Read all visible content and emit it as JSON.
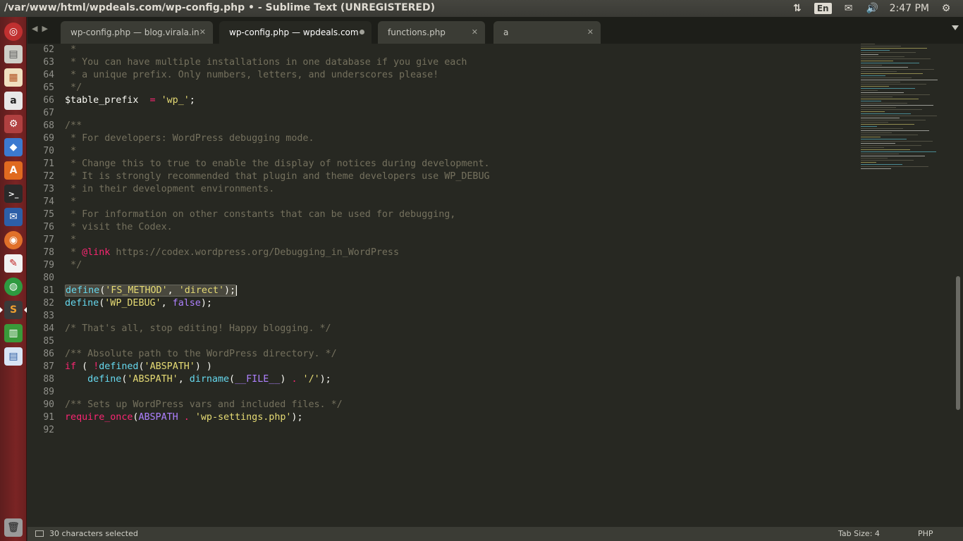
{
  "window_title": "/var/www/html/wpdeals.com/wp-config.php • - Sublime Text (UNREGISTERED)",
  "tray": {
    "language": "En",
    "time": "2:47 PM"
  },
  "launcher_items": [
    "ubuntu",
    "files",
    "document-viewer",
    "amazon",
    "system-settings",
    "virtualbox",
    "software-center",
    "terminal",
    "thunderbird",
    "firefox",
    "text-editor",
    "chrome",
    "sublime-text",
    "libreoffice-calc",
    "libreoffice-writer",
    "trash"
  ],
  "tabs": [
    {
      "label": "wp-config.php — blog.virala.in",
      "state": "close"
    },
    {
      "label": "wp-config.php — wpdeals.com",
      "state": "dirty"
    },
    {
      "label": "functions.php",
      "state": "close"
    },
    {
      "label": "a",
      "state": "close"
    }
  ],
  "line_numbers": [
    "62",
    "63",
    "64",
    "65",
    "66",
    "67",
    "68",
    "69",
    "70",
    "71",
    "72",
    "73",
    "74",
    "75",
    "76",
    "77",
    "78",
    "79",
    "80",
    "81",
    "82",
    "83",
    "84",
    "85",
    "86",
    "87",
    "88",
    "89",
    "90",
    "91",
    "92"
  ],
  "code_lines": [
    [
      [
        "c",
        " *"
      ]
    ],
    [
      [
        "c",
        " * You can have multiple installations in one database if you give each"
      ]
    ],
    [
      [
        "c",
        " * a unique prefix. Only numbers, letters, and underscores please!"
      ]
    ],
    [
      [
        "c",
        " */"
      ]
    ],
    [
      [
        "v",
        "$table_prefix  "
      ],
      [
        "o",
        "="
      ],
      [
        "v",
        " "
      ],
      [
        "s",
        "'wp_'"
      ],
      [
        "v",
        ";"
      ]
    ],
    [
      [
        "v",
        ""
      ]
    ],
    [
      [
        "c",
        "/**"
      ]
    ],
    [
      [
        "c",
        " * For developers: WordPress debugging mode."
      ]
    ],
    [
      [
        "c",
        " *"
      ]
    ],
    [
      [
        "c",
        " * Change this to true to enable the display of notices during development."
      ]
    ],
    [
      [
        "c",
        " * It is strongly recommended that plugin and theme developers use WP_DEBUG"
      ]
    ],
    [
      [
        "c",
        " * in their development environments."
      ]
    ],
    [
      [
        "c",
        " *"
      ]
    ],
    [
      [
        "c",
        " * For information on other constants that can be used for debugging,"
      ]
    ],
    [
      [
        "c",
        " * visit the Codex."
      ]
    ],
    [
      [
        "c",
        " *"
      ]
    ],
    [
      [
        "c",
        " * "
      ],
      [
        "k",
        "@link"
      ],
      [
        "c",
        " https://codex.wordpress.org/Debugging_in_WordPress"
      ]
    ],
    [
      [
        "c",
        " */"
      ]
    ],
    [
      [
        "v",
        ""
      ]
    ],
    [
      [
        "f",
        "define"
      ],
      [
        "v",
        "("
      ],
      [
        "s",
        "'FS_METHOD'"
      ],
      [
        "v",
        ", "
      ],
      [
        "s",
        "'direct'"
      ],
      [
        "v",
        ");"
      ]
    ],
    [
      [
        "f",
        "define"
      ],
      [
        "v",
        "("
      ],
      [
        "s",
        "'WP_DEBUG'"
      ],
      [
        "v",
        ", "
      ],
      [
        "n",
        "false"
      ],
      [
        "v",
        ");"
      ]
    ],
    [
      [
        "v",
        ""
      ]
    ],
    [
      [
        "c",
        "/* That's all, stop editing! Happy blogging. */"
      ]
    ],
    [
      [
        "v",
        ""
      ]
    ],
    [
      [
        "c",
        "/** Absolute path to the WordPress directory. */"
      ]
    ],
    [
      [
        "k",
        "if"
      ],
      [
        "v",
        " ( "
      ],
      [
        "o",
        "!"
      ],
      [
        "f",
        "defined"
      ],
      [
        "v",
        "("
      ],
      [
        "s",
        "'ABSPATH'"
      ],
      [
        "v",
        ") )"
      ]
    ],
    [
      [
        "v",
        "    "
      ],
      [
        "f",
        "define"
      ],
      [
        "v",
        "("
      ],
      [
        "s",
        "'ABSPATH'"
      ],
      [
        "v",
        ", "
      ],
      [
        "f",
        "dirname"
      ],
      [
        "v",
        "("
      ],
      [
        "n",
        "__FILE__"
      ],
      [
        "v",
        ") "
      ],
      [
        "o",
        "."
      ],
      [
        "v",
        " "
      ],
      [
        "s",
        "'/'"
      ],
      [
        "v",
        ");"
      ]
    ],
    [
      [
        "v",
        ""
      ]
    ],
    [
      [
        "c",
        "/** Sets up WordPress vars and included files. */"
      ]
    ],
    [
      [
        "k",
        "require_once"
      ],
      [
        "v",
        "("
      ],
      [
        "n",
        "ABSPATH"
      ],
      [
        "v",
        " "
      ],
      [
        "o",
        "."
      ],
      [
        "v",
        " "
      ],
      [
        "s",
        "'wp-settings.php'"
      ],
      [
        "v",
        ");"
      ]
    ],
    [
      [
        "v",
        ""
      ]
    ]
  ],
  "selected_line": "81",
  "status": {
    "message": "30 characters selected",
    "tab_size": "Tab Size: 4",
    "syntax": "PHP"
  },
  "colors": {
    "background": "#272822",
    "comment": "#75715e",
    "string": "#e6db74",
    "function": "#66d9ef",
    "keyword": "#f92672",
    "constant": "#ae81ff",
    "launcher": "#7a2424"
  }
}
